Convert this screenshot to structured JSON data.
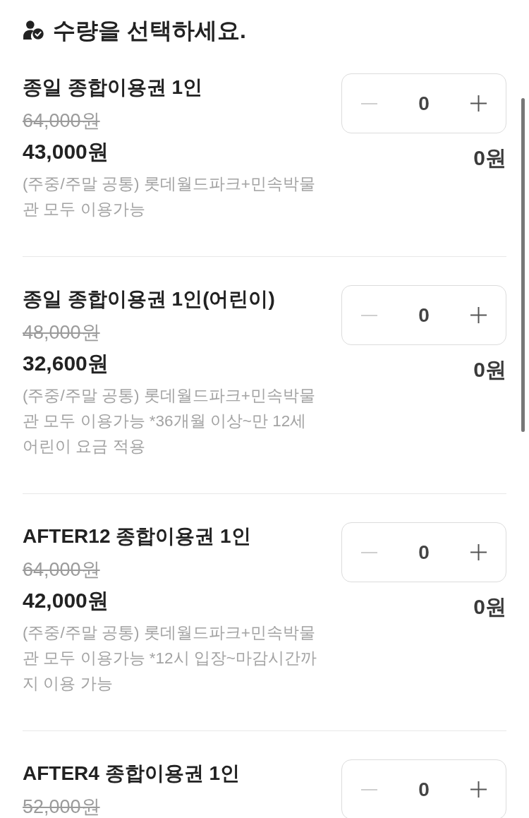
{
  "header": {
    "title": "수량을 선택하세요."
  },
  "products": [
    {
      "name": "종일 종합이용권 1인",
      "original_price": "64,000원",
      "price": "43,000원",
      "description": "(주중/주말 공통) 롯데월드파크+민속박물관 모두 이용가능",
      "decrement_disabled": true,
      "quantity": "0",
      "total": "0원"
    },
    {
      "name": "종일 종합이용권 1인(어린이)",
      "original_price": "48,000원",
      "price": "32,600원",
      "description": "(주중/주말 공통) 롯데월드파크+민속박물관 모두 이용가능 *36개월 이상~만 12세 어린이 요금 적용",
      "decrement_disabled": true,
      "quantity": "0",
      "total": "0원"
    },
    {
      "name": "AFTER12 종합이용권 1인",
      "original_price": "64,000원",
      "price": "42,000원",
      "description": "(주중/주말 공통) 롯데월드파크+민속박물관 모두 이용가능 *12시 입장~마감시간까지 이용 가능",
      "decrement_disabled": true,
      "quantity": "0",
      "total": "0원"
    },
    {
      "name": "AFTER4 종합이용권 1인",
      "original_price": "52,000원",
      "decrement_disabled": true,
      "quantity": "0"
    }
  ]
}
